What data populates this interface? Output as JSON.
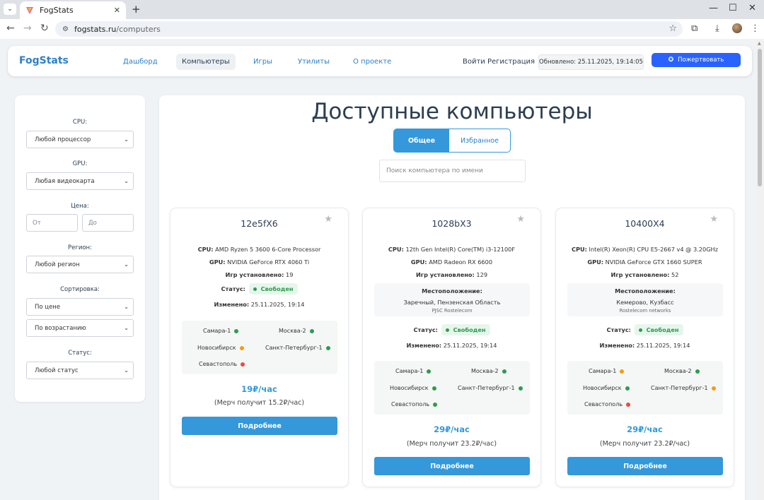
{
  "browser": {
    "tab_title": "FogStats",
    "url_host": "fogstats.ru",
    "url_path": "/computers"
  },
  "header": {
    "logo": "FogStats",
    "nav": [
      {
        "label": "Дашборд",
        "active": false
      },
      {
        "label": "Компьютеры",
        "active": true
      },
      {
        "label": "Игры",
        "active": false
      },
      {
        "label": "Утилиты",
        "active": false
      },
      {
        "label": "О проекте",
        "active": false
      }
    ],
    "login": "Войти",
    "register": "Регистрация",
    "updated": "Обновлено: 25.11.2025, 19:14:05",
    "donate": "Пожертвовать"
  },
  "filters": {
    "cpu_label": "CPU:",
    "cpu_value": "Любой процессор",
    "gpu_label": "GPU:",
    "gpu_value": "Любая видеокарта",
    "price_label": "Цена:",
    "price_from": "От",
    "price_to": "До",
    "region_label": "Регион:",
    "region_value": "Любой регион",
    "sort_label": "Сортировка:",
    "sort_by": "По цене",
    "sort_order": "По возрастанию",
    "status_label": "Статус:",
    "status_value": "Любой статус"
  },
  "main": {
    "title": "Доступные компьютеры",
    "tab_general": "Общее",
    "tab_favorites": "Избранное",
    "search_placeholder": "Поиск компьютера по имени"
  },
  "labels": {
    "cpu": "CPU:",
    "gpu": "GPU:",
    "games": "Игр установлено:",
    "status": "Статус:",
    "changed": "Изменено:",
    "location": "Местоположение:",
    "details": "Подробнее"
  },
  "colors": {
    "green": "#2e9b4f",
    "orange": "#f39c12",
    "red": "#e74c3c",
    "accent": "#3498db"
  },
  "cards": [
    {
      "name": "12e5fX6",
      "cpu": "AMD Ryzen 5 3600 6-Core Processor",
      "gpu": "NVIDIA GeForce RTX 4060 Ti",
      "games": "19",
      "status": "Свободен",
      "changed": "25.11.2025, 19:14",
      "location": null,
      "servers": [
        {
          "name": "Самара-1",
          "state": "green"
        },
        {
          "name": "Москва-2",
          "state": "green"
        },
        {
          "name": "Новосибирск",
          "state": "orange"
        },
        {
          "name": "Санкт-Петербург-1",
          "state": "green"
        },
        {
          "name": "Севастополь",
          "state": "red"
        }
      ],
      "price": "19₽/час",
      "merch": "(Мерч получит 15.2₽/час)"
    },
    {
      "name": "1028bX3",
      "cpu": "12th Gen Intel(R) Core(TM) i3-12100F",
      "gpu": "AMD Radeon RX 6600",
      "games": "129",
      "status": "Свободен",
      "changed": "25.11.2025, 19:14",
      "location": {
        "place": "Заречный, Пензенская Область",
        "isp": "PJSC Rostelecom"
      },
      "servers": [
        {
          "name": "Самара-1",
          "state": "green"
        },
        {
          "name": "Москва-2",
          "state": "green"
        },
        {
          "name": "Новосибирск",
          "state": "green"
        },
        {
          "name": "Санкт-Петербург-1",
          "state": "green"
        },
        {
          "name": "Севастополь",
          "state": "green"
        }
      ],
      "price": "29₽/час",
      "merch": "(Мерч получит 23.2₽/час)"
    },
    {
      "name": "10400X4",
      "cpu": "Intel(R) Xeon(R) CPU E5-2667 v4 @ 3.20GHz",
      "gpu": "NVIDIA GeForce GTX 1660 SUPER",
      "games": "52",
      "status": "Свободен",
      "changed": "25.11.2025, 19:14",
      "location": {
        "place": "Кемерово, Кузбасс",
        "isp": "Rostelecom networks"
      },
      "servers": [
        {
          "name": "Самара-1",
          "state": "orange"
        },
        {
          "name": "Москва-2",
          "state": "green"
        },
        {
          "name": "Новосибирск",
          "state": "green"
        },
        {
          "name": "Санкт-Петербург-1",
          "state": "orange"
        },
        {
          "name": "Севастополь",
          "state": "red"
        }
      ],
      "price": "29₽/час",
      "merch": "(Мерч получит 23.2₽/час)"
    }
  ]
}
